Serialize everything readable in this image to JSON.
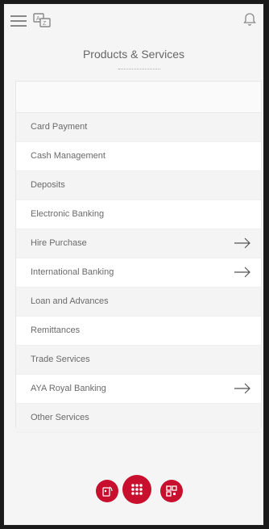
{
  "header": {
    "title": "Products & Services",
    "icons": {
      "menu": "hamburger-menu-icon",
      "language": "translate-icon",
      "notifications": "bell-icon"
    }
  },
  "list": {
    "items": [
      {
        "label": "Card Payment",
        "has_arrow": false
      },
      {
        "label": "Cash Management",
        "has_arrow": false
      },
      {
        "label": "Deposits",
        "has_arrow": false
      },
      {
        "label": "Electronic Banking",
        "has_arrow": false
      },
      {
        "label": "Hire Purchase",
        "has_arrow": true
      },
      {
        "label": "International Banking",
        "has_arrow": true
      },
      {
        "label": "Loan and Advances",
        "has_arrow": false
      },
      {
        "label": "Remittances",
        "has_arrow": false
      },
      {
        "label": "Trade Services",
        "has_arrow": false
      },
      {
        "label": "AYA Royal Banking",
        "has_arrow": true
      },
      {
        "label": "Other Services",
        "has_arrow": false
      }
    ]
  },
  "bottom_nav": {
    "left_icon": "tap-card-icon",
    "center_icon": "grid-menu-icon",
    "right_icon": "qr-code-icon",
    "accent_color": "#c8102e"
  }
}
